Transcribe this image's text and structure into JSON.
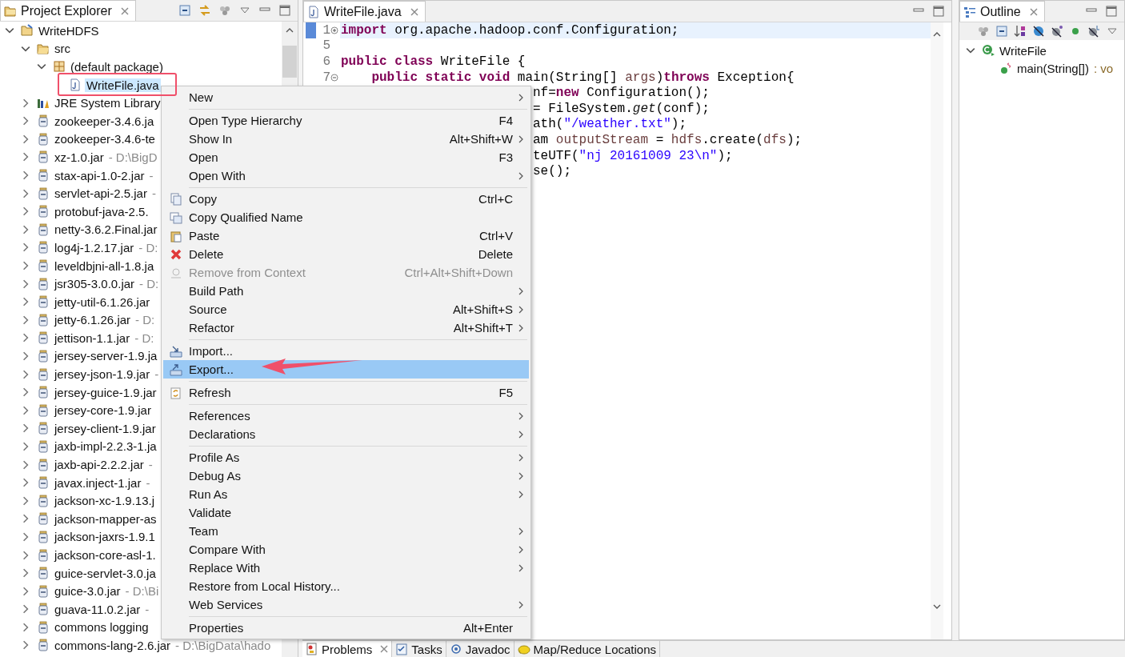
{
  "explorer": {
    "tab": {
      "label": "Project Explorer"
    },
    "tree": [
      {
        "label": "WriteHDFS",
        "kind": "project",
        "expanded": true,
        "children": [
          {
            "label": "src",
            "kind": "folder",
            "expanded": true,
            "children": [
              {
                "label": "(default package)",
                "kind": "package",
                "expanded": true,
                "children": [
                  {
                    "label": "WriteFile.java",
                    "kind": "java",
                    "selected": true
                  }
                ]
              }
            ]
          },
          {
            "label": "JRE System Library",
            "kind": "library",
            "expanded": false
          },
          {
            "label": "zookeeper-3.4.6.ja",
            "kind": "jar",
            "expanded": false
          },
          {
            "label": "zookeeper-3.4.6-te",
            "kind": "jar",
            "expanded": false
          },
          {
            "label": "xz-1.0.jar",
            "detail": "- D:\\BigD",
            "kind": "jar",
            "expanded": false
          },
          {
            "label": "stax-api-1.0-2.jar",
            "detail": "-",
            "kind": "jar",
            "expanded": false
          },
          {
            "label": "servlet-api-2.5.jar",
            "detail": "-",
            "kind": "jar",
            "expanded": false
          },
          {
            "label": "protobuf-java-2.5.",
            "kind": "jar",
            "expanded": false
          },
          {
            "label": "netty-3.6.2.Final.jar",
            "kind": "jar",
            "expanded": false
          },
          {
            "label": "log4j-1.2.17.jar",
            "detail": "- D:",
            "kind": "jar",
            "expanded": false
          },
          {
            "label": "leveldbjni-all-1.8.ja",
            "kind": "jar",
            "expanded": false
          },
          {
            "label": "jsr305-3.0.0.jar",
            "detail": "- D:",
            "kind": "jar",
            "expanded": false
          },
          {
            "label": "jetty-util-6.1.26.jar",
            "kind": "jar",
            "expanded": false
          },
          {
            "label": "jetty-6.1.26.jar",
            "detail": "- D:",
            "kind": "jar",
            "expanded": false
          },
          {
            "label": "jettison-1.1.jar",
            "detail": "- D:",
            "kind": "jar",
            "expanded": false
          },
          {
            "label": "jersey-server-1.9.ja",
            "kind": "jar",
            "expanded": false
          },
          {
            "label": "jersey-json-1.9.jar",
            "detail": "-",
            "kind": "jar",
            "expanded": false
          },
          {
            "label": "jersey-guice-1.9.jar",
            "kind": "jar",
            "expanded": false
          },
          {
            "label": "jersey-core-1.9.jar",
            "kind": "jar",
            "expanded": false
          },
          {
            "label": "jersey-client-1.9.jar",
            "kind": "jar",
            "expanded": false
          },
          {
            "label": "jaxb-impl-2.2.3-1.ja",
            "kind": "jar",
            "expanded": false
          },
          {
            "label": "jaxb-api-2.2.2.jar",
            "detail": "-",
            "kind": "jar",
            "expanded": false
          },
          {
            "label": "javax.inject-1.jar",
            "detail": "-",
            "kind": "jar",
            "expanded": false
          },
          {
            "label": "jackson-xc-1.9.13.j",
            "kind": "jar",
            "expanded": false
          },
          {
            "label": "jackson-mapper-as",
            "kind": "jar",
            "expanded": false
          },
          {
            "label": "jackson-jaxrs-1.9.1",
            "kind": "jar",
            "expanded": false
          },
          {
            "label": "jackson-core-asl-1.",
            "kind": "jar",
            "expanded": false
          },
          {
            "label": "guice-servlet-3.0.ja",
            "kind": "jar",
            "expanded": false
          },
          {
            "label": "guice-3.0.jar",
            "detail": "- D:\\Bi",
            "kind": "jar",
            "expanded": false
          },
          {
            "label": "guava-11.0.2.jar",
            "detail": "-",
            "kind": "jar",
            "expanded": false
          },
          {
            "label": "commons logging",
            "kind": "jar",
            "expanded": false
          },
          {
            "label": "commons-lang-2.6.jar",
            "detail": "- D:\\BigData\\hado",
            "kind": "jar",
            "expanded": false
          }
        ]
      }
    ]
  },
  "editor": {
    "tab": {
      "label": "WriteFile.java"
    },
    "lines": [
      {
        "number": "1",
        "folded": true,
        "current": true,
        "tokens": [
          {
            "kind": "kw",
            "t": "import"
          },
          {
            "kind": "plain",
            "t": " org.apache.hadoop.conf.Configuration;"
          }
        ]
      },
      {
        "number": "5",
        "current": false
      },
      {
        "number": "6",
        "current": false,
        "tokens": [
          {
            "kind": "kw",
            "t": "public class"
          },
          {
            "kind": "plain",
            "t": " WriteFile {"
          }
        ]
      },
      {
        "number": "7",
        "folded": false,
        "current": false,
        "tokens": [
          {
            "kind": "kw",
            "t": "    public static void"
          },
          {
            "kind": "plain",
            "t": " main(String[] "
          },
          {
            "kind": "var",
            "t": "args"
          },
          {
            "kind": "plain",
            "t": ")"
          },
          {
            "kind": "kw",
            "t": "throws"
          },
          {
            "kind": "plain",
            "t": " Exception{"
          }
        ]
      },
      {
        "partial": true,
        "current": false,
        "tokens": [
          {
            "kind": "plain",
            "t": "nf="
          },
          {
            "kind": "kw",
            "t": "new"
          },
          {
            "kind": "plain",
            "t": " Configuration();"
          }
        ]
      },
      {
        "partial": true,
        "current": false,
        "tokens": [
          {
            "kind": "plain",
            "t": "= FileSystem."
          },
          {
            "kind": "static",
            "t": "get"
          },
          {
            "kind": "plain",
            "t": "(conf);"
          }
        ]
      },
      {
        "partial": true,
        "current": false,
        "tokens": [
          {
            "kind": "plain",
            "t": "ath("
          },
          {
            "kind": "str",
            "t": "\"/weather.txt\""
          },
          {
            "kind": "plain",
            "t": ");"
          }
        ]
      },
      {
        "partial": true,
        "current": false,
        "tokens": [
          {
            "kind": "plain",
            "t": "am "
          },
          {
            "kind": "var",
            "t": "outputStream"
          },
          {
            "kind": "plain",
            "t": " = "
          },
          {
            "kind": "var",
            "t": "hdfs"
          },
          {
            "kind": "plain",
            "t": ".create("
          },
          {
            "kind": "var",
            "t": "dfs"
          },
          {
            "kind": "plain",
            "t": ");"
          }
        ]
      },
      {
        "partial": true,
        "current": false,
        "tokens": [
          {
            "kind": "plain",
            "t": "teUTF("
          },
          {
            "kind": "str",
            "t": "\"nj 20161009 23\\n\""
          },
          {
            "kind": "plain",
            "t": ");"
          }
        ]
      },
      {
        "partial": true,
        "current": false,
        "tokens": [
          {
            "kind": "plain",
            "t": "se();"
          }
        ]
      }
    ]
  },
  "outline": {
    "tab": {
      "label": "Outline"
    },
    "tree": [
      {
        "label": "WriteFile",
        "kind": "class",
        "expanded": true,
        "children": [
          {
            "label": "main(String[])",
            "detail": ": vo",
            "kind": "method"
          }
        ]
      }
    ]
  },
  "bottom_tabs": [
    {
      "label": "Problems",
      "kind": "problems",
      "selected": true
    },
    {
      "label": "Tasks",
      "kind": "tasks",
      "selected": false
    },
    {
      "label": "Javadoc",
      "kind": "javadoc",
      "selected": false
    },
    {
      "label": "Map/Reduce Locations",
      "kind": "mapreduce",
      "selected": false
    }
  ],
  "context_menu": {
    "groups": [
      [
        {
          "label": "New",
          "submenu": true
        }
      ],
      [
        {
          "label": "Open Type Hierarchy",
          "shortcut": "F4",
          "submenu": false
        },
        {
          "label": "Show In",
          "shortcut": "Alt+Shift+W",
          "submenu": true
        },
        {
          "label": "Open",
          "shortcut": "F3",
          "submenu": false
        },
        {
          "label": "Open With",
          "submenu": true
        }
      ],
      [
        {
          "label": "Copy",
          "kind": "copy",
          "shortcut": "Ctrl+C",
          "submenu": false
        },
        {
          "label": "Copy Qualified Name",
          "kind": "copy-name",
          "submenu": false
        },
        {
          "label": "Paste",
          "kind": "paste",
          "shortcut": "Ctrl+V",
          "submenu": false
        },
        {
          "label": "Delete",
          "kind": "delete",
          "shortcut": "Delete",
          "submenu": false
        },
        {
          "label": "Remove from Context",
          "kind": "remove",
          "shortcut": "Ctrl+Alt+Shift+Down",
          "submenu": false,
          "disabled": true
        },
        {
          "label": "Build Path",
          "submenu": true
        },
        {
          "label": "Source",
          "shortcut": "Alt+Shift+S",
          "submenu": true
        },
        {
          "label": "Refactor",
          "shortcut": "Alt+Shift+T",
          "submenu": true
        }
      ],
      [
        {
          "label": "Import...",
          "kind": "import",
          "submenu": false,
          "selected": false
        },
        {
          "label": "Export...",
          "kind": "export",
          "submenu": false,
          "selected": true
        }
      ],
      [
        {
          "label": "Refresh",
          "kind": "refresh",
          "shortcut": "F5",
          "submenu": false
        }
      ],
      [
        {
          "label": "References",
          "submenu": true
        },
        {
          "label": "Declarations",
          "submenu": true
        }
      ],
      [
        {
          "label": "Profile As",
          "submenu": true
        },
        {
          "label": "Debug As",
          "submenu": true
        },
        {
          "label": "Run As",
          "submenu": true
        },
        {
          "label": "Validate",
          "submenu": false
        },
        {
          "label": "Team",
          "submenu": true
        },
        {
          "label": "Compare With",
          "submenu": true
        },
        {
          "label": "Replace With",
          "submenu": true
        },
        {
          "label": "Restore from Local History...",
          "submenu": false
        },
        {
          "label": "Web Services",
          "submenu": true
        }
      ],
      [
        {
          "label": "Properties",
          "shortcut": "Alt+Enter",
          "submenu": false
        }
      ]
    ]
  }
}
